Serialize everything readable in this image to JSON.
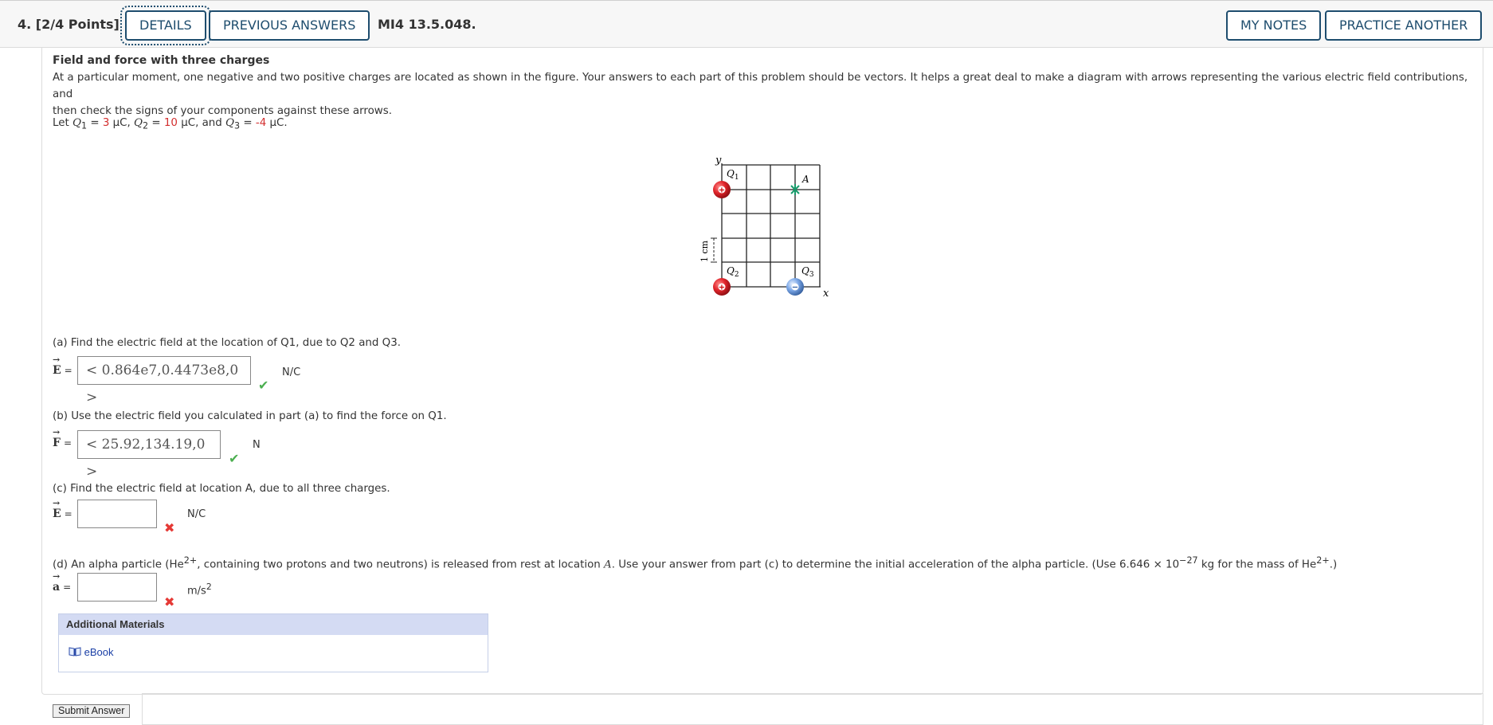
{
  "header": {
    "question_number": "4.",
    "points": "[2/4 Points]",
    "details_label": "DETAILS",
    "previous_answers_label": "PREVIOUS ANSWERS",
    "question_code": "MI4 13.5.048.",
    "my_notes_label": "MY NOTES",
    "practice_another_label": "PRACTICE ANOTHER"
  },
  "problem": {
    "title": "Field and force with three charges",
    "intro_1": "At a particular moment, one negative and two positive charges are located as shown in the figure. Your answers to each part of this problem should be vectors. It helps a great deal to make a diagram with arrows representing the various electric field contributions, and",
    "intro_2": "then check the signs of your components against these arrows.",
    "let_prefix": "Let ",
    "q1_name": "Q",
    "q1_value": "3",
    "q2_value": "10",
    "q3_value": "-4",
    "unit_uc": "μC"
  },
  "figure": {
    "y_label": "y",
    "x_label": "x",
    "scale_label": "1 cm",
    "q1_label": "Q",
    "q2_label": "Q",
    "q3_label": "Q",
    "a_label": "A",
    "positive_sign": "+",
    "negative_sign": "−"
  },
  "parts": {
    "a": {
      "question": "(a) Find the electric field at the location of Q1, due to Q2 and Q3.",
      "label": "E",
      "value": "< 0.864e7,0.4473e8,0 >",
      "unit": "N/C",
      "status": "correct"
    },
    "b": {
      "question": "(b) Use the electric field you calculated in part (a) to find the force on Q1.",
      "label": "F",
      "value": "< 25.92,134.19,0 >",
      "unit": "N",
      "status": "correct"
    },
    "c": {
      "question": "(c) Find the electric field at location A, due to all three charges.",
      "label": "E",
      "value": "",
      "unit": "N/C",
      "status": "incorrect"
    },
    "d": {
      "question_1": "(d) An alpha particle (He",
      "question_2": ", containing two protons and two neutrons) is released from rest at location ",
      "question_3": ". Use your answer from part (c) to determine the initial acceleration of the alpha particle. (Use 6.646 × 10",
      "question_4": " kg for the mass of He",
      "question_5": ".)",
      "he_charge": "2+",
      "exp": "−27",
      "loc": "A",
      "label": "a",
      "value": "",
      "unit": "m/s",
      "unit_exp": "2",
      "status": "incorrect"
    }
  },
  "equals": "=",
  "check_icon": "✔",
  "cross_icon": "✖",
  "additional": {
    "title": "Additional Materials",
    "ebook_label": "eBook"
  },
  "submit_label": "Submit Answer"
}
